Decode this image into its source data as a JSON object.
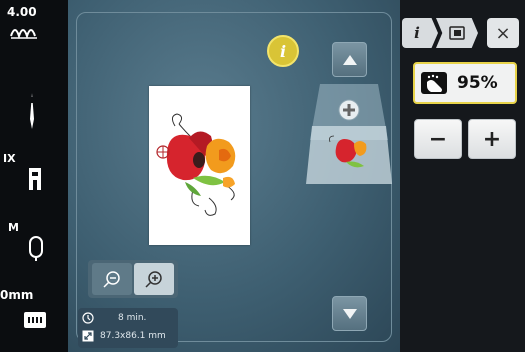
{
  "sidebar": {
    "tension_value": "4.00",
    "presser_foot_code": "IX",
    "bobbin_code": "M",
    "width_value": "0mm"
  },
  "canvas": {
    "info_button_label": "i",
    "zoom_out_icon": "zoom-out-icon",
    "zoom_in_icon": "zoom-in-icon",
    "stitch_time": "8 min.",
    "design_size": "87.3x86.1 mm"
  },
  "panel": {
    "tab_info_label": "i",
    "close_label": "×",
    "speed_value": "95%",
    "minus_label": "−",
    "plus_label": "+"
  },
  "colors": {
    "accent": "#e7d34a",
    "canvas": "#4a6b7d"
  }
}
